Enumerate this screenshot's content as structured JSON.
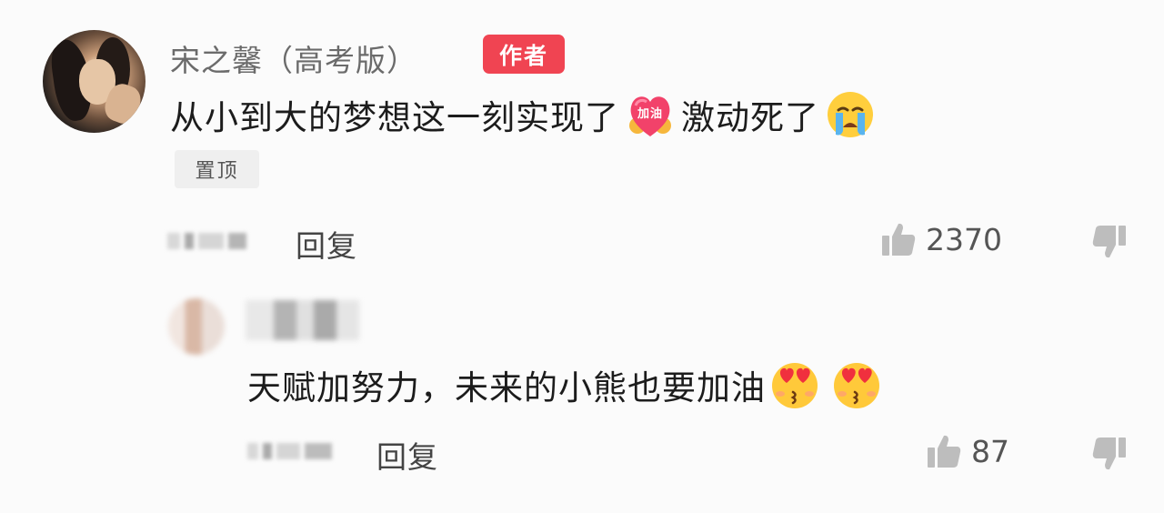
{
  "main_comment": {
    "username": "宋之馨（高考版）",
    "author_badge": "作者",
    "text_before_emoji": "从小到大的梦想这一刻实现了",
    "sticker_label": "加油",
    "text_after_emoji": "激动死了",
    "pinned_label": "置顶",
    "reply_label": "回复",
    "like_count": "2370",
    "icons": [
      "heart-sticker-icon",
      "crying-face-icon",
      "thumbs-up-icon",
      "thumbs-down-icon"
    ]
  },
  "reply_comment": {
    "text": "天赋加努力，未来的小熊也要加油",
    "reply_label": "回复",
    "like_count": "87",
    "icons": [
      "heart-eyes-face-icon",
      "heart-eyes-face-icon",
      "thumbs-up-icon",
      "thumbs-down-icon"
    ]
  },
  "colors": {
    "badge": "#f04452",
    "username": "#6b6b6b",
    "text": "#1c1c1c",
    "background": "#fbfbfb"
  }
}
